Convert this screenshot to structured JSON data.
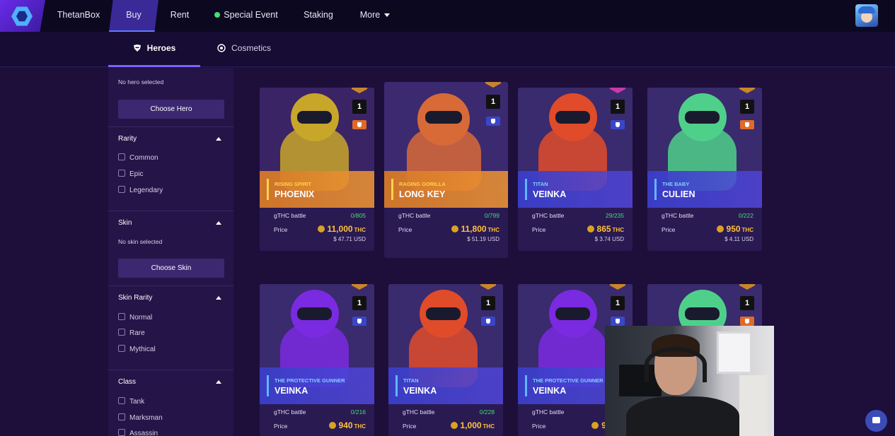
{
  "nav": {
    "items": [
      "ThetanBox",
      "Buy",
      "Rent",
      "Special Event",
      "Staking",
      "More"
    ],
    "active": "Buy"
  },
  "subnav": {
    "tabs": [
      "Heroes",
      "Cosmetics"
    ],
    "active": "Heroes"
  },
  "sidebar": {
    "hero_status": "No hero selected",
    "choose_hero": "Choose Hero",
    "rarity": {
      "title": "Rarity",
      "options": [
        "Common",
        "Epic",
        "Legendary"
      ]
    },
    "skin": {
      "title": "Skin",
      "status": "No skin selected",
      "button": "Choose Skin"
    },
    "skin_rarity": {
      "title": "Skin Rarity",
      "options": [
        "Normal",
        "Rare",
        "Mythical"
      ]
    },
    "class": {
      "title": "Class",
      "options": [
        "Tank",
        "Marksman",
        "Assassin"
      ]
    }
  },
  "labels": {
    "battle": "gTHC battle",
    "price": "Price",
    "currency": "THC"
  },
  "cards": [
    {
      "sub": "RISING SPIRIT",
      "name": "PHOENIX",
      "rarity": "H",
      "level": "1",
      "battle": "0/805",
      "price": "11,000",
      "usd": "$ 47.71 USD",
      "band": "orange",
      "class": "orange"
    },
    {
      "sub": "RAGING GORILLA",
      "name": "LONG KEY",
      "rarity": "H",
      "level": "1",
      "battle": "0/799",
      "price": "11,800",
      "usd": "$ 51.19 USD",
      "band": "orange",
      "class": "blue"
    },
    {
      "sub": "TITAN",
      "name": "VEINKA",
      "rarity": "G",
      "level": "1",
      "battle": "29/235",
      "price": "865",
      "usd": "$ 3.74 USD",
      "band": "blue",
      "class": "blue"
    },
    {
      "sub": "THE BABY",
      "name": "CULIEN",
      "rarity": "H",
      "level": "1",
      "battle": "0/222",
      "price": "950",
      "usd": "$ 4.11 USD",
      "band": "blue",
      "class": "orange"
    },
    {
      "sub": "THE PROTECTIVE GUNNER",
      "name": "VEINKA",
      "rarity": "H",
      "level": "1",
      "battle": "0/216",
      "price": "940",
      "usd": "",
      "band": "blue",
      "class": "blue"
    },
    {
      "sub": "TITAN",
      "name": "VEINKA",
      "rarity": "H",
      "level": "1",
      "battle": "0/228",
      "price": "1,000",
      "usd": "",
      "band": "blue",
      "class": "blue"
    },
    {
      "sub": "THE PROTECTIVE GUNNER",
      "name": "VEINKA",
      "rarity": "H",
      "level": "1",
      "battle": "",
      "price": "94",
      "usd": "",
      "band": "blue",
      "class": "blue"
    },
    {
      "sub": "",
      "name": "",
      "rarity": "H",
      "level": "1",
      "battle": "",
      "price": "",
      "usd": "",
      "band": "blue",
      "class": "orange"
    }
  ],
  "colors": {
    "nav_bg": "#0c0820",
    "page_bg": "#1d0f3a",
    "card_bg": "#2a1a52",
    "accent": "#5d7cff",
    "count_green": "#3ee070",
    "thc_gold": "#ffc23a"
  }
}
